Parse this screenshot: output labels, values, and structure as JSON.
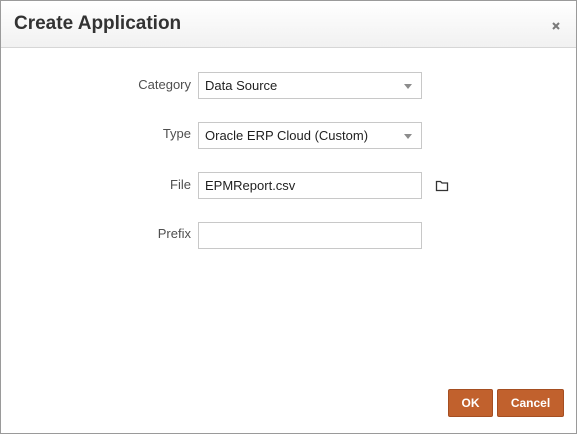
{
  "dialog": {
    "title": "Create Application",
    "close_icon": "close-icon"
  },
  "form": {
    "category": {
      "label": "Category",
      "value": "Data Source"
    },
    "type": {
      "label": "Type",
      "value": "Oracle ERP Cloud (Custom)"
    },
    "file": {
      "label": "File",
      "value": "EPMReport.csv",
      "browse_icon": "folder-icon"
    },
    "prefix": {
      "label": "Prefix",
      "value": ""
    }
  },
  "footer": {
    "ok_label": "OK",
    "cancel_label": "Cancel"
  },
  "colors": {
    "button": "#c1612d"
  }
}
